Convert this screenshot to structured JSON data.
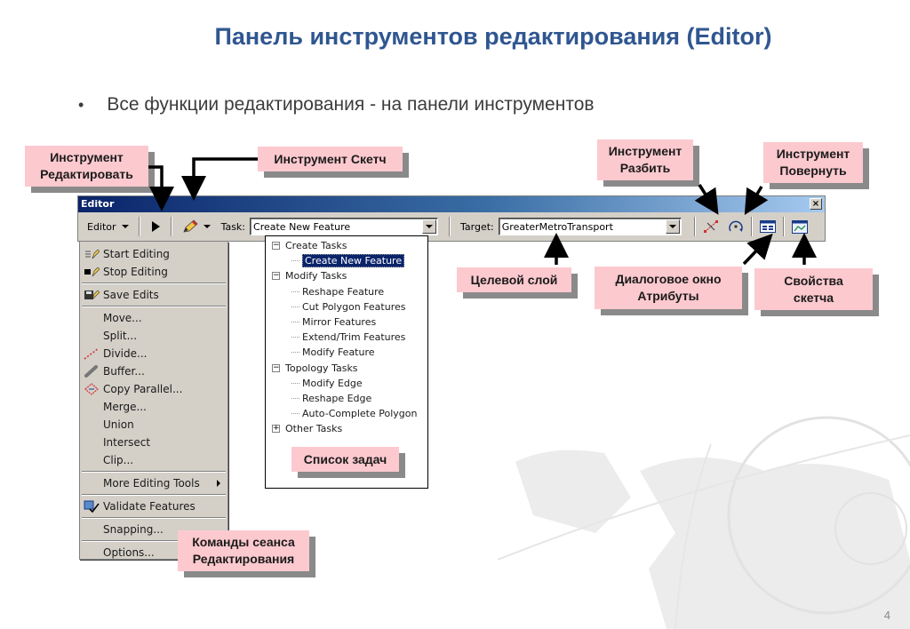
{
  "slide": {
    "title": "Панель инструментов редактирования (Editor)",
    "bullet": "Все функции редактирования - на панели инструментов",
    "page_number": "4"
  },
  "toolbar": {
    "window_title": "Editor",
    "close_label": "×",
    "editor_menu_label": "Editor",
    "task_label": "Task:",
    "task_value": "Create New Feature",
    "target_label": "Target:",
    "target_value": "GreaterMetroTransport",
    "icons": [
      "edit-tool-arrow",
      "sketch-pencil",
      "split-tool",
      "rotate-tool",
      "attributes-dialog",
      "sketch-properties"
    ]
  },
  "editor_menu": {
    "items": [
      {
        "label": "Start Editing",
        "icon": "start-editing-icon"
      },
      {
        "label": "Stop Editing",
        "icon": "stop-editing-icon"
      },
      {
        "label": "Save Edits",
        "icon": "save-edits-icon"
      },
      {
        "label": "Move..."
      },
      {
        "label": "Split..."
      },
      {
        "label": "Divide...",
        "icon": "divide-icon"
      },
      {
        "label": "Buffer...",
        "icon": "buffer-icon"
      },
      {
        "label": "Copy Parallel...",
        "icon": "copy-parallel-icon"
      },
      {
        "label": "Merge..."
      },
      {
        "label": "Union"
      },
      {
        "label": "Intersect"
      },
      {
        "label": "Clip..."
      },
      {
        "label": "More Editing Tools",
        "submenu": true
      },
      {
        "label": "Validate Features",
        "icon": "validate-features-icon"
      },
      {
        "label": "Snapping..."
      },
      {
        "label": "Options..."
      }
    ]
  },
  "task_tree": {
    "groups": [
      {
        "label": "Create Tasks",
        "expanded": true,
        "children": [
          "Create New Feature"
        ]
      },
      {
        "label": "Modify Tasks",
        "expanded": true,
        "children": [
          "Reshape Feature",
          "Cut Polygon Features",
          "Mirror Features",
          "Extend/Trim Features",
          "Modify Feature"
        ]
      },
      {
        "label": "Topology Tasks",
        "expanded": true,
        "children": [
          "Modify Edge",
          "Reshape Edge",
          "Auto-Complete Polygon"
        ]
      },
      {
        "label": "Other Tasks",
        "expanded": false,
        "children": []
      }
    ],
    "selected": "Create New Feature"
  },
  "callouts": {
    "edit_tool": "Инструмент Редактировать",
    "sketch_tool": "Инструмент Скетч",
    "split_tool": "Инструмент Разбить",
    "rotate_tool": "Инструмент Повернуть",
    "target_layer": "Целевой слой",
    "attributes_dialog": "Диалоговое окно Атрибуты",
    "sketch_properties": "Свойства скетча",
    "task_list": "Список задач",
    "session_commands": "Команды сеанса Редактирования"
  },
  "colors": {
    "title": "#2f5690",
    "callout_bg": "#fcc9cf",
    "callout_shadow": "#8a8a8a",
    "titlebar_start": "#0a246a",
    "titlebar_end": "#a6caf0",
    "selection": "#0a246a"
  }
}
